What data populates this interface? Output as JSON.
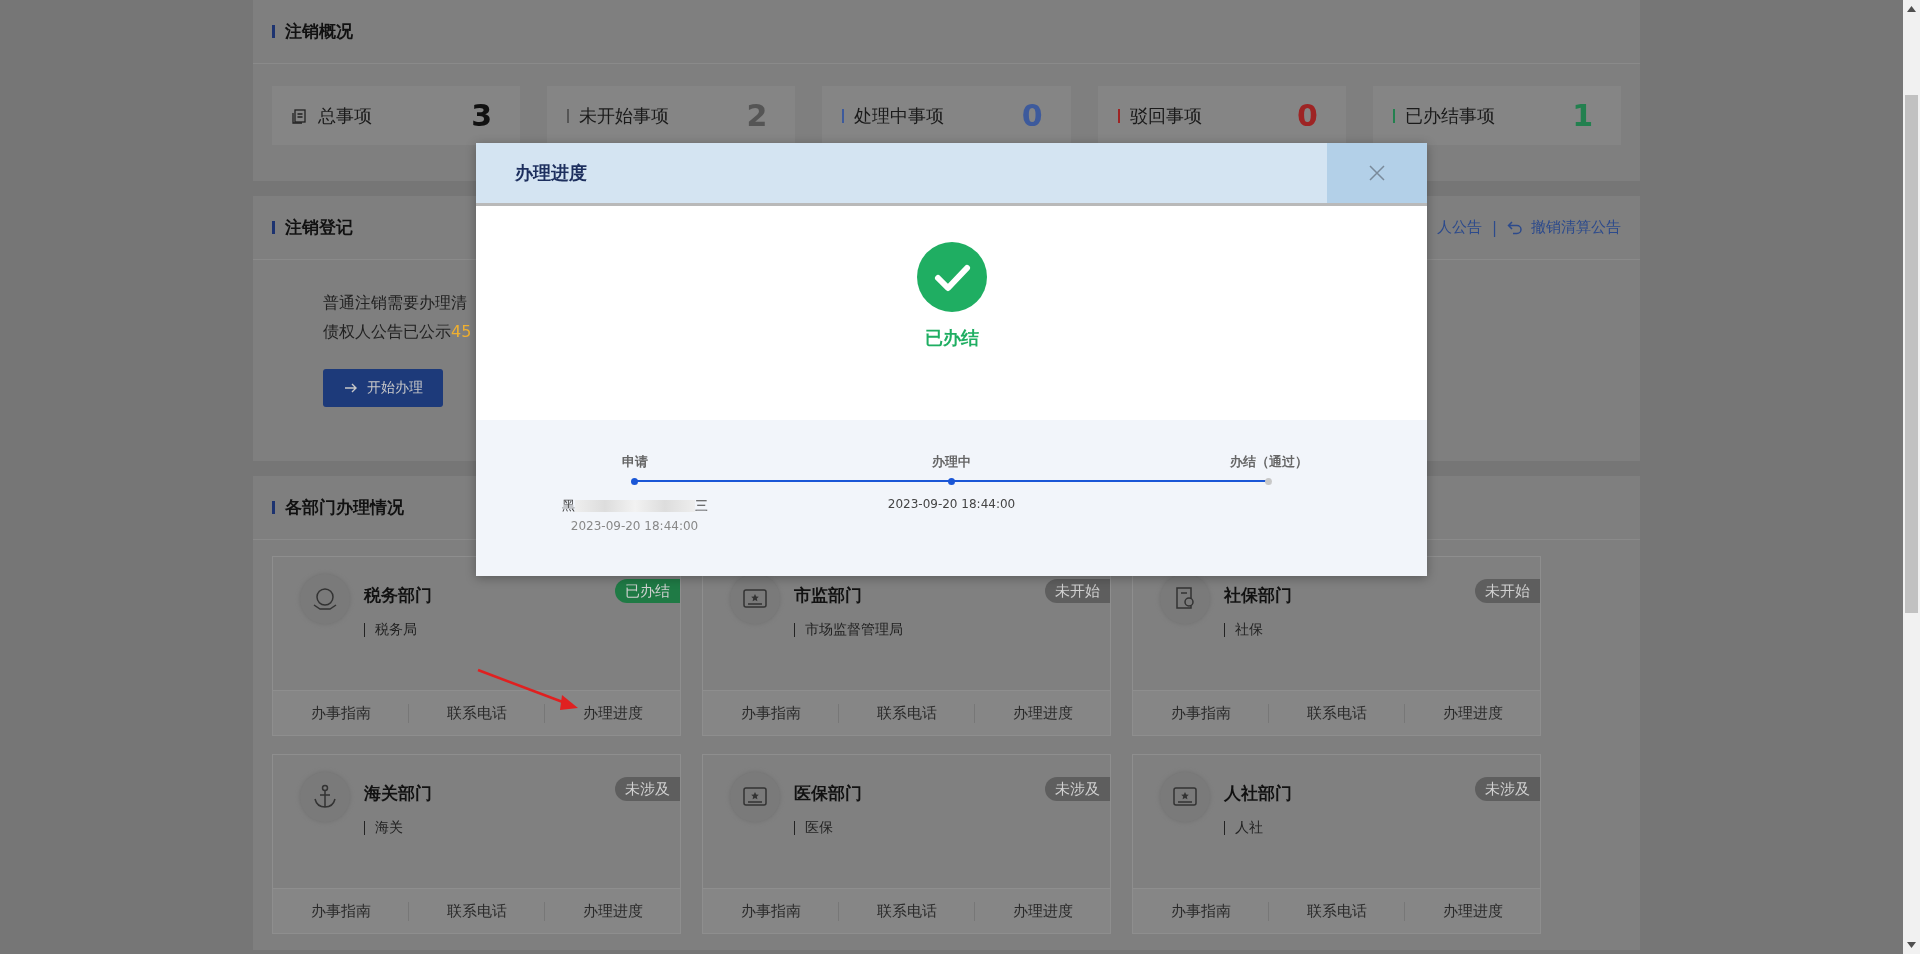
{
  "summary": {
    "title": "注销概况",
    "stats": [
      {
        "kind": "total",
        "label": "总事项",
        "value": "3",
        "color": "#111111"
      },
      {
        "kind": "status",
        "label": "未开始事项",
        "value": "2",
        "color": "#555555"
      },
      {
        "kind": "status",
        "label": "处理中事项",
        "value": "0",
        "color": "#3d5a9c"
      },
      {
        "kind": "status",
        "label": "驳回事项",
        "value": "0",
        "color": "#9e2424"
      },
      {
        "kind": "status",
        "label": "已办结事项",
        "value": "1",
        "color": "#23804f"
      }
    ]
  },
  "registration": {
    "title": "注销登记",
    "links": [
      {
        "kind": "plain",
        "label": "人公告"
      },
      {
        "kind": "undo",
        "label": "撤销清算公告"
      }
    ],
    "separator": "|",
    "lines": [
      {
        "text": "普通注销需要办理清"
      },
      {
        "text": "债权人公告已公示",
        "highlight": "45"
      }
    ],
    "button": "开始办理"
  },
  "departments": {
    "title": "各部门办理情况",
    "cards": [
      {
        "kind": "tax",
        "name": "税务部门",
        "agency": "税务局",
        "color": "#1f7a45",
        "badge": "已办结",
        "actions": [
          "办事指南",
          "联系电话",
          "办理进度"
        ]
      },
      {
        "kind": "card",
        "name": "市监部门",
        "agency": "市场监督管理局",
        "color": "#5e5e5e",
        "badge": "未开始",
        "actions": [
          "办事指南",
          "联系电话",
          "办理进度"
        ]
      },
      {
        "kind": "certificate",
        "name": "社保部门",
        "agency": "社保",
        "color": "#5e5e5e",
        "badge": "未开始",
        "actions": [
          "办事指南",
          "联系电话",
          "办理进度"
        ]
      },
      {
        "kind": "anchor",
        "name": "海关部门",
        "agency": "海关",
        "color": "#5e5e5e",
        "badge": "未涉及",
        "actions": [
          "办事指南",
          "联系电话",
          "办理进度"
        ]
      },
      {
        "kind": "card",
        "name": "医保部门",
        "agency": "医保",
        "color": "#5e5e5e",
        "badge": "未涉及",
        "actions": [
          "办事指南",
          "联系电话",
          "办理进度"
        ]
      },
      {
        "kind": "card",
        "name": "人社部门",
        "agency": "人社",
        "color": "#5e5e5e",
        "badge": "未涉及",
        "actions": [
          "办事指南",
          "联系电话",
          "办理进度"
        ]
      }
    ]
  },
  "modal": {
    "title": "办理进度",
    "result": "已办结",
    "steps": [
      {
        "label": "申请",
        "done": true,
        "name_start": "黑",
        "name_end": "三",
        "time": "2023-09-20 18:44:00"
      },
      {
        "label": "办理中",
        "done": true,
        "time": "2023-09-20 18:44:00"
      },
      {
        "label": "办结（通过）",
        "done": false
      }
    ]
  }
}
